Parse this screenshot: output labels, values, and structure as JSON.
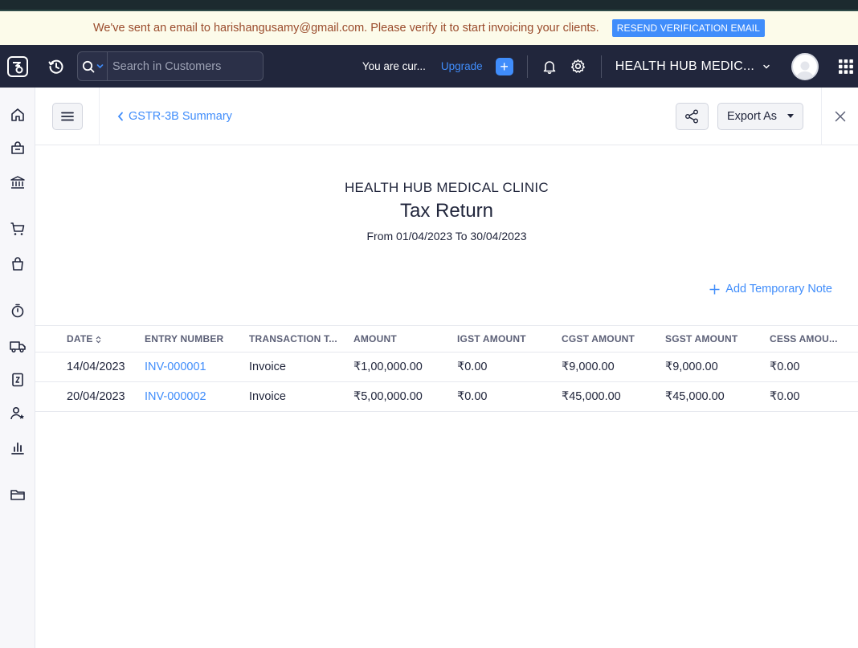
{
  "banner": {
    "message": "We've sent an email to harishangusamy@gmail.com. Please verify it to start invoicing your clients.",
    "resend_label": "RESEND VERIFICATION EMAIL"
  },
  "header": {
    "search_placeholder": "Search in Customers",
    "trial_text": "You are cur...",
    "upgrade_label": "Upgrade",
    "plus_label": "+",
    "org_name": "HEALTH HUB MEDIC..."
  },
  "sidebar": {
    "items": [
      {
        "icon": "home-icon"
      },
      {
        "icon": "items-icon"
      },
      {
        "icon": "banking-icon"
      },
      {
        "icon": "sales-cart-icon"
      },
      {
        "icon": "purchases-bag-icon"
      },
      {
        "icon": "time-tracking-icon"
      },
      {
        "icon": "eway-bill-truck-icon"
      },
      {
        "icon": "gst-filing-icon"
      },
      {
        "icon": "accountant-icon"
      },
      {
        "icon": "reports-icon"
      },
      {
        "icon": "documents-folder-icon"
      }
    ]
  },
  "subheader": {
    "back_label": "GSTR-3B Summary",
    "export_label": "Export As"
  },
  "report": {
    "org_title": "HEALTH HUB MEDICAL CLINIC",
    "title": "Tax Return",
    "range": "From 01/04/2023 To 30/04/2023",
    "add_note_label": "Add Temporary Note",
    "columns": [
      "DATE",
      "ENTRY NUMBER",
      "TRANSACTION T...",
      "AMOUNT",
      "IGST AMOUNT",
      "CGST AMOUNT",
      "SGST AMOUNT",
      "CESS AMOU..."
    ],
    "rows": [
      [
        "14/04/2023",
        "INV-000001",
        "Invoice",
        "₹1,00,000.00",
        "₹0.00",
        "₹9,000.00",
        "₹9,000.00",
        "₹0.00"
      ],
      [
        "20/04/2023",
        "INV-000002",
        "Invoice",
        "₹5,00,000.00",
        "₹0.00",
        "₹45,000.00",
        "₹45,000.00",
        "₹0.00"
      ]
    ]
  },
  "colors": {
    "accent": "#408dfb",
    "header_bg": "#21263c",
    "banner_bg": "#fcfbea",
    "banner_text": "#9a4b2c"
  }
}
